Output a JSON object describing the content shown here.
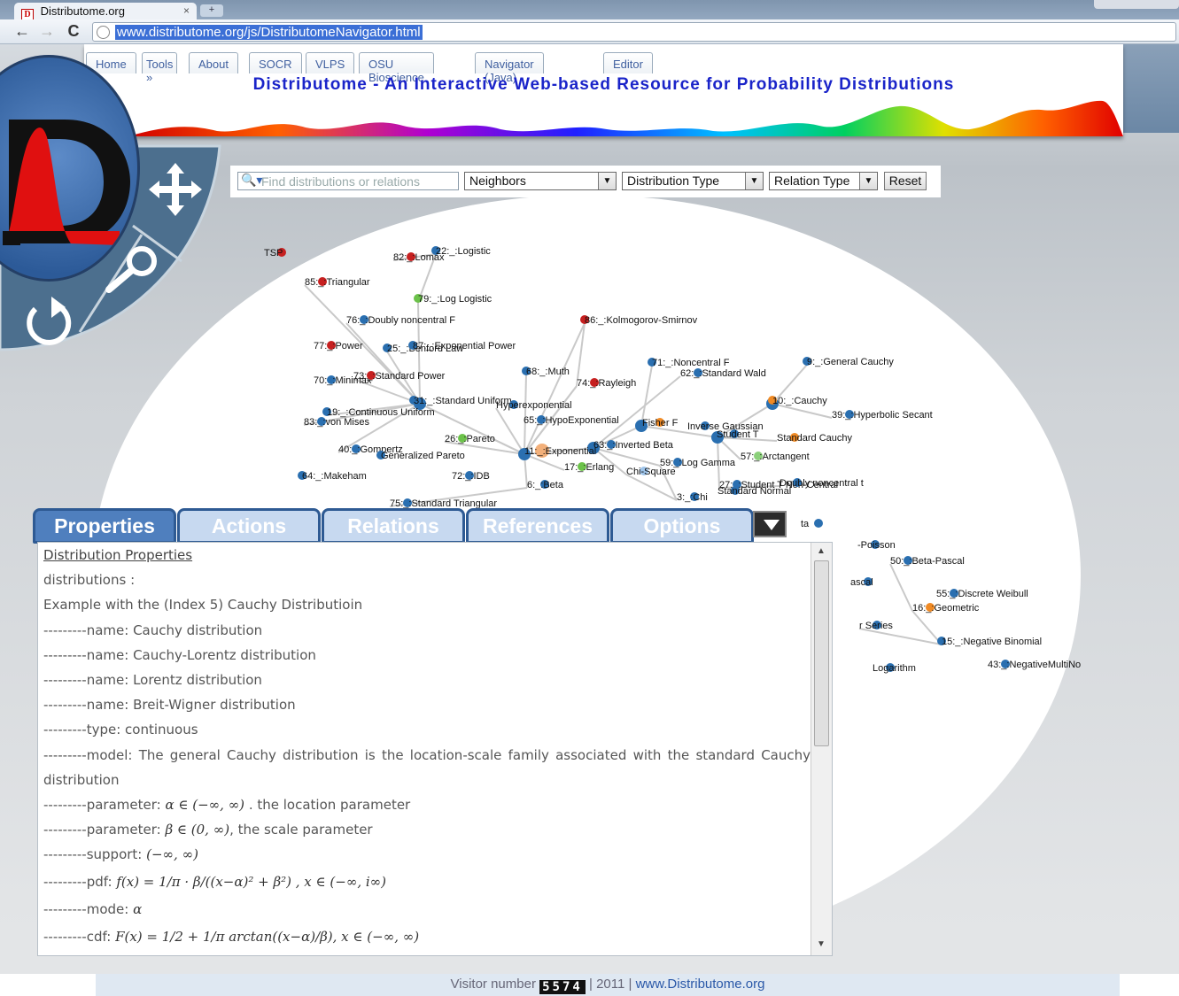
{
  "browser": {
    "tab_title": "Distributome.org",
    "tab_close": "×",
    "new_tab": "+",
    "url": "www.distributome.org/js/DistributomeNavigator.html",
    "back": "←",
    "forward": "→",
    "reload": "C"
  },
  "site": {
    "tabs": [
      "Home",
      "Tools »",
      "About",
      "SOCR",
      "VLPS",
      "OSU Bioscience",
      "Navigator (Java)",
      "Editor"
    ],
    "title": "Distributome - An Interactive Web-based Resource for Probability Distributions",
    "favicon": "D"
  },
  "controls": {
    "search_placeholder": "Find distributions or relations",
    "neighbors": "Neighbors",
    "distribution_type": "Distribution Type",
    "relation_type": "Relation Type",
    "reset": "Reset"
  },
  "graph": {
    "nodes": [
      {
        "label": "TSP",
        "color": "#c62020"
      },
      {
        "label": "82:_:Lomax",
        "color": "#c62020"
      },
      {
        "label": "22:_:Logistic",
        "color": "#2a6fb0"
      },
      {
        "label": "85:_:Triangular",
        "color": "#c62020"
      },
      {
        "label": "79:_:Log Logistic",
        "color": "#6cc24a"
      },
      {
        "label": "76:_:Doubly noncentral F",
        "color": "#2a6fb0"
      },
      {
        "label": "86:_:Kolmogorov-Smirnov",
        "color": "#c62020"
      },
      {
        "label": "77:_:Power",
        "color": "#c62020"
      },
      {
        "label": "25:_:Benford Law",
        "color": "#2a6fb0"
      },
      {
        "label": "87:_:Exponential Power",
        "color": "#2a6fb0"
      },
      {
        "label": "68:_:Muth",
        "color": "#2a6fb0"
      },
      {
        "label": "71:_:Noncentral F",
        "color": "#2a6fb0"
      },
      {
        "label": "9:_:General Cauchy",
        "color": "#2a6fb0"
      },
      {
        "label": "62:_:Standard Wald",
        "color": "#2a6fb0"
      },
      {
        "label": "70:_:Minimax",
        "color": "#2a6fb0"
      },
      {
        "label": "73:_:Standard Power",
        "color": "#c62020"
      },
      {
        "label": "74:_:Rayleigh",
        "color": "#c62020"
      },
      {
        "label": "31:_:Standard Uniform",
        "color": "#2a6fb0"
      },
      {
        "label": "Hyperexponential",
        "color": "#2a6fb0"
      },
      {
        "label": "10:_:Cauchy",
        "color": "#f08a24"
      },
      {
        "label": "19:_:Continuous Uniform",
        "color": "#2a6fb0"
      },
      {
        "label": "39:_:Hyperbolic Secant",
        "color": "#2a6fb0"
      },
      {
        "label": "83:_:von Mises",
        "color": "#2a6fb0"
      },
      {
        "label": "65:_:HypoExponential",
        "color": "#2a6fb0"
      },
      {
        "label": "Fisher F",
        "color": "#f08a24"
      },
      {
        "label": "Inverse Gaussian",
        "color": "#2a6fb0"
      },
      {
        "label": "Student T",
        "color": "#2a6fb0"
      },
      {
        "label": "Standard Cauchy",
        "color": "#f08a24"
      },
      {
        "label": "26:_:Pareto",
        "color": "#6cc24a"
      },
      {
        "label": "40:_:Gompertz",
        "color": "#2a6fb0"
      },
      {
        "label": "Generalized Pareto",
        "color": "#2a6fb0"
      },
      {
        "label": "11:_:Exponential",
        "color": "#f3b07a"
      },
      {
        "label": "63:_:Inverted Beta",
        "color": "#2a6fb0"
      },
      {
        "label": "57:_:Arctangent",
        "color": "#8bd07a"
      },
      {
        "label": "17:_:Erlang",
        "color": "#6cc24a"
      },
      {
        "label": "59:_:Log Gamma",
        "color": "#2a6fb0"
      },
      {
        "label": "Chi-Square",
        "color": "#9ec4ea"
      },
      {
        "label": "64:_:Makeham",
        "color": "#2a6fb0"
      },
      {
        "label": "72:_:IDB",
        "color": "#2a6fb0"
      },
      {
        "label": "27:_:Student T Non-Central",
        "color": "#2a6fb0"
      },
      {
        "label": "Doubly noncentral t",
        "color": "#2a6fb0"
      },
      {
        "label": "Standard Normal",
        "color": "#2a6fb0"
      },
      {
        "label": "6:_:Beta",
        "color": "#2a6fb0"
      },
      {
        "label": "3:_:Chi",
        "color": "#2a6fb0"
      },
      {
        "label": "75:_:Standard Triangular",
        "color": "#2a6fb0"
      },
      {
        "label": "-Poisson",
        "color": "#2a6fb0"
      },
      {
        "label": "50:_:Beta-Pascal",
        "color": "#2a6fb0"
      },
      {
        "label": "ascal",
        "color": "#2a6fb0"
      },
      {
        "label": "55:_:Discrete Weibull",
        "color": "#2a6fb0"
      },
      {
        "label": "16:_:Geometric",
        "color": "#f08a24"
      },
      {
        "label": "r Series",
        "color": "#2a6fb0"
      },
      {
        "label": "15:_:Negative Binomial",
        "color": "#2a6fb0"
      },
      {
        "label": "Logarithm",
        "color": "#2a6fb0"
      },
      {
        "label": "43:_:NegativeMultiNo",
        "color": "#2a6fb0"
      },
      {
        "label": "ta",
        "color": "#2a6fb0"
      }
    ]
  },
  "tabs": {
    "properties": "Properties",
    "actions": "Actions",
    "relations": "Relations",
    "references": "References",
    "options": "Options"
  },
  "properties": {
    "heading": "Distribution Properties",
    "lines": {
      "distributions": "distributions :",
      "example": "Example with the (Index 5) Cauchy Distributioin",
      "name1": "---------name: Cauchy distribution",
      "name2": "---------name: Cauchy-Lorentz distribution",
      "name3": "---------name: Lorentz distribution",
      "name4": "---------name: Breit-Wigner distribution",
      "type": "---------type: continuous",
      "model": "---------model: The general Cauchy distribution is the location-scale family associated with the standard Cauchy distribution",
      "param1_prefix": "---------parameter: ",
      "param1_math": "α ∈ (−∞, ∞)",
      "param1_suffix": ". the location parameter",
      "param2_prefix": "---------parameter: ",
      "param2_math": "β ∈ (0, ∞)",
      "param2_suffix": ", the scale parameter",
      "support_prefix": "---------support: ",
      "support_math": "(−∞, ∞)",
      "pdf_prefix": "---------pdf: ",
      "pdf_math": "f(x) = 1/π · β/((x−α)² + β²) , x ∈ (−∞, i∞)",
      "mode_prefix": "---------mode: ",
      "mode_math": "α",
      "cdf_prefix": "---------cdf: ",
      "cdf_math": "F(x) = 1/2 + 1/π arctan((x−α)/β), x ∈ (−∞, ∞)"
    }
  },
  "footer": {
    "visitor_label": "Visitor number",
    "visitor_count": "5574",
    "year": "| 2011 |",
    "link": "www.Distributome.org"
  }
}
